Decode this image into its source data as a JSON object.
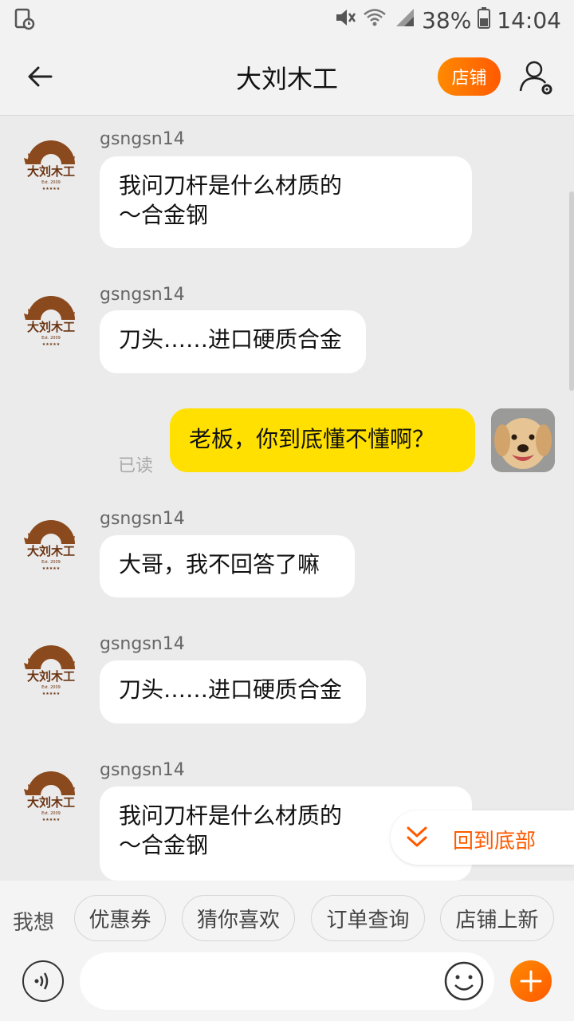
{
  "status_bar": {
    "battery": "38%",
    "time": "14:04"
  },
  "header": {
    "title": "大刘木工",
    "shop_button": "店铺"
  },
  "messages": [
    {
      "from": "shop",
      "sender": "gsngsn14",
      "text_line1": "我问刀杆是什么材质的",
      "text_line2": "～合金钢"
    },
    {
      "from": "shop",
      "sender": "gsngsn14",
      "text": "刀头……进口硬质合金"
    },
    {
      "from": "me",
      "text": "老板，你到底懂不懂啊？",
      "status": "已读"
    },
    {
      "from": "shop",
      "sender": "gsngsn14",
      "text": "大哥，我不回答了嘛"
    },
    {
      "from": "shop",
      "sender": "gsngsn14",
      "text": "刀头……进口硬质合金"
    },
    {
      "from": "shop",
      "sender": "gsngsn14",
      "text_line1": "我问刀杆是什么材质的",
      "text_line2": "～合金钢"
    }
  ],
  "shop_logo_text": "大刘木工",
  "back_to_bottom": "回到底部",
  "quick_bar": {
    "prefix": "我想",
    "chips": [
      "优惠券",
      "猜你喜欢",
      "订单查询",
      "店铺上新"
    ]
  },
  "input": {
    "placeholder": ""
  },
  "colors": {
    "accent": "#ff6a00",
    "my_bubble": "#ffe000",
    "background": "#ebebeb"
  }
}
